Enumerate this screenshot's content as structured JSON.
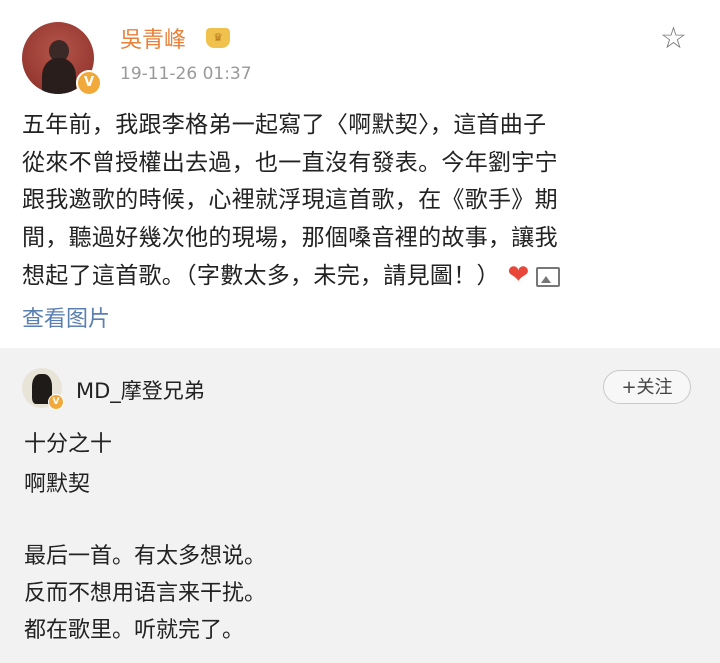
{
  "post": {
    "username": "吳青峰",
    "crown_icon": "crown-icon",
    "verified_badge": "V",
    "timestamp": "19-11-26 01:37",
    "star_icon": "star-icon",
    "lines": [
      "五年前，我跟李格弟一起寫了〈啊默契〉，這首曲子",
      "從來不曾授權出去過，也一直沒有發表。今年劉宇宁",
      "跟我邀歌的時候，心裡就浮現這首歌，在《歌手》期",
      "間，聽過好幾次他的現場，那個嗓音裡的故事，讓我",
      "想起了這首歌。（字數太多，未完，請見圖！）"
    ],
    "heart": "❤",
    "view_images": "查看图片"
  },
  "comment": {
    "username": "MD_摩登兄弟",
    "follow_label": "+关注",
    "lines": [
      "十分之十",
      "啊默契",
      "最后一首。有太多想说。",
      "反而不想用语言来干扰。",
      "都在歌里。听就完了。"
    ]
  }
}
